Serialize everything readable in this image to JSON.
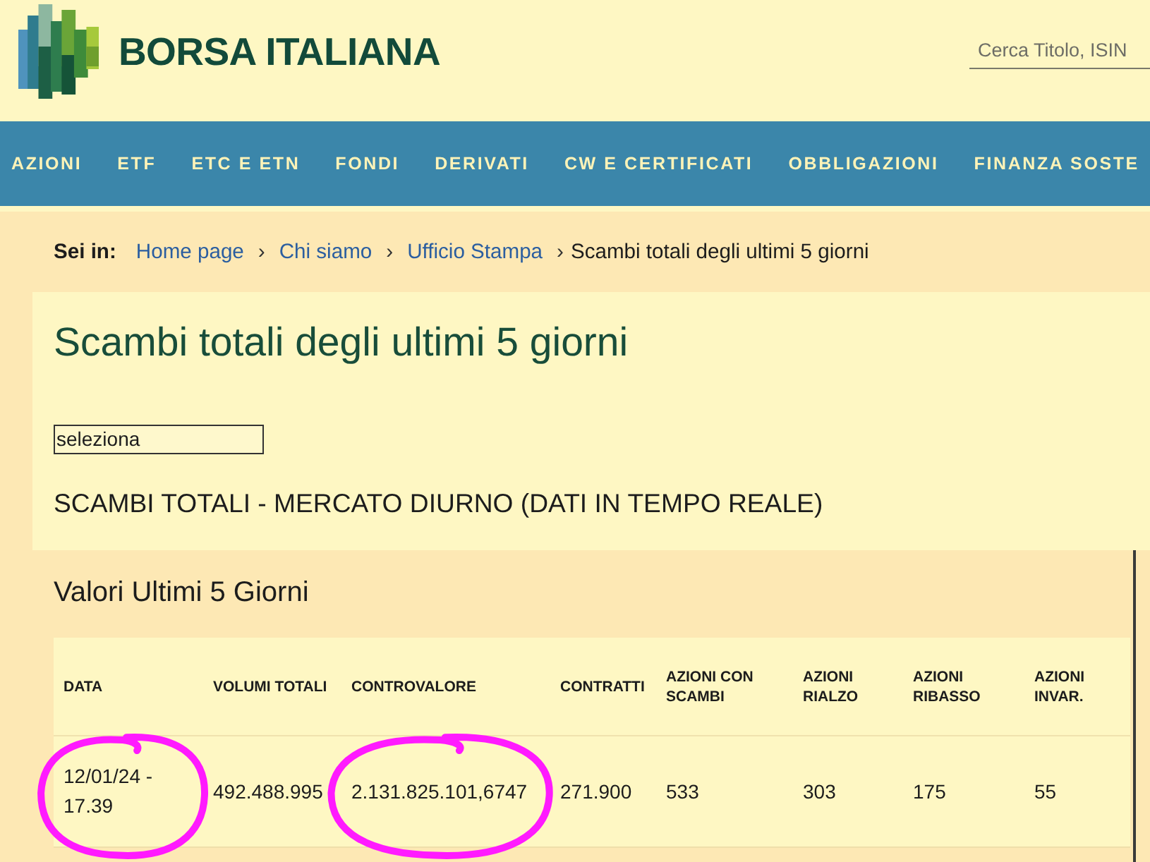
{
  "header": {
    "brand": "BORSA ITALIANA",
    "search": {
      "placeholder": "Cerca Titolo, ISIN"
    }
  },
  "nav": [
    "AZIONI",
    "ETF",
    "ETC E ETN",
    "FONDI",
    "DERIVATI",
    "CW E CERTIFICATI",
    "OBBLIGAZIONI",
    "FINANZA SOSTE"
  ],
  "breadcrumb": [
    {
      "kind": "label",
      "text": "Sei in:"
    },
    {
      "kind": "link",
      "text": "Home page"
    },
    {
      "kind": "separator",
      "text": "›"
    },
    {
      "kind": "link",
      "text": "Chi siamo"
    },
    {
      "kind": "separator",
      "text": "›"
    },
    {
      "kind": "link",
      "text": "Ufficio Stampa"
    },
    {
      "kind": "separator",
      "text": "›"
    },
    {
      "kind": "current",
      "text": "Scambi totali degli ultimi 5 giorni"
    }
  ],
  "page": {
    "title": "Scambi totali degli ultimi 5 giorni",
    "select": {
      "value": "seleziona"
    },
    "subtitle": "SCAMBI TOTALI - MERCATO DIURNO (DATI IN TEMPO REALE)"
  },
  "table": {
    "title": "Valori Ultimi 5 Giorni",
    "columns": [
      "DATA",
      "VOLUMI TOTALI",
      "CONTROVALORE",
      "CONTRATTI",
      "AZIONI CON SCAMBI",
      "AZIONI RIALZO",
      "AZIONI RIBASSO",
      "AZIONI INVAR."
    ],
    "rows": [
      {
        "cells": [
          {
            "text": "12/01/24 - 17.39",
            "circled": true
          },
          {
            "text": "492.488.995",
            "circled": false
          },
          {
            "text": "2.131.825.101,6747",
            "circled": true
          },
          {
            "text": "271.900",
            "circled": false
          },
          {
            "text": "533",
            "circled": false
          },
          {
            "text": "303",
            "circled": false
          },
          {
            "text": "175",
            "circled": false
          },
          {
            "text": "55",
            "circled": false
          }
        ]
      }
    ]
  }
}
